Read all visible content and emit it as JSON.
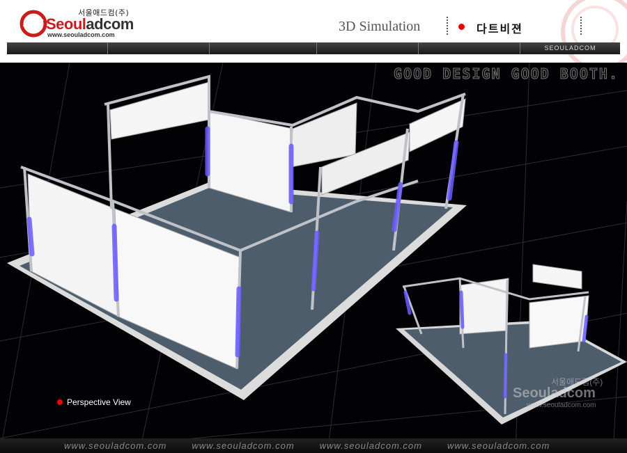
{
  "header": {
    "logo": {
      "korean": "서울애드컴(주)",
      "name_red": "Seoul",
      "name_dark": "adcom",
      "url": "www.seouladcom.com"
    },
    "section_title": "3D Simulation",
    "page_title": "다트비젼"
  },
  "nav": {
    "brand": "SEOULADCOM"
  },
  "stage": {
    "slogan": "GOOD DESIGN GOOD BOOTH.",
    "view_label": "Perspective View",
    "watermark": {
      "korean": "서울애드컴(주)",
      "name": "Seouladcom",
      "url": "www.seouladcom.com"
    }
  },
  "footer": {
    "urls": [
      "www.seouladcom.com",
      "www.seouladcom.com",
      "www.seouladcom.com",
      "www.seouladcom.com"
    ]
  },
  "colors": {
    "accent_red": "#e00000",
    "brand_red": "#c81c1c",
    "led_blue": "#6a5cff",
    "floor": "#4e5d6c"
  }
}
